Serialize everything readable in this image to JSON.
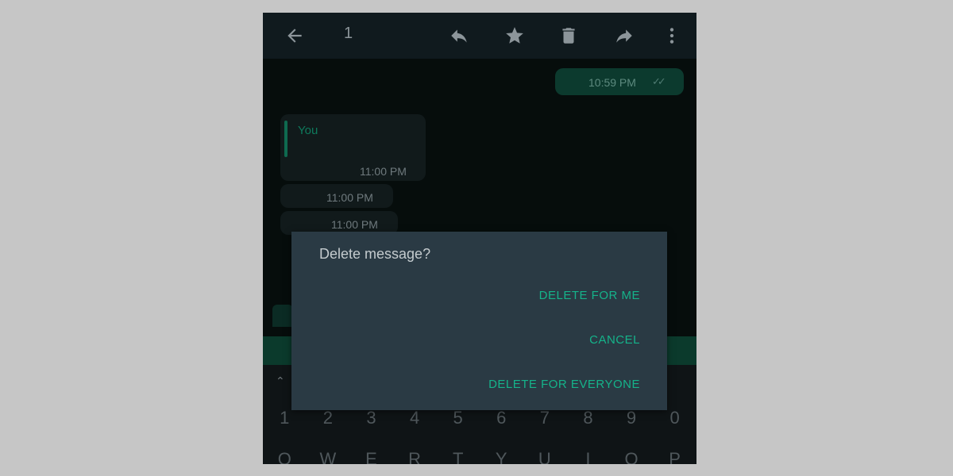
{
  "app_bar": {
    "selected_count": "1",
    "icons": [
      "back-arrow-icon",
      "reply-icon",
      "star-icon",
      "delete-icon",
      "forward-icon",
      "more-vert-icon"
    ]
  },
  "messages": [
    {
      "direction": "outgoing",
      "time": "10:59 PM",
      "status": "read-checks"
    },
    {
      "direction": "incoming",
      "quote_name": "You",
      "time": "11:00 PM"
    },
    {
      "direction": "incoming",
      "time": "11:00 PM"
    },
    {
      "direction": "incoming",
      "time": "11:00 PM"
    }
  ],
  "keyboard": {
    "number_row": [
      "1",
      "2",
      "3",
      "4",
      "5",
      "6",
      "7",
      "8",
      "9",
      "0"
    ],
    "letter_row": [
      "Q",
      "W",
      "E",
      "R",
      "T",
      "Y",
      "U",
      "I",
      "O",
      "P"
    ]
  },
  "dialog": {
    "title": "Delete message?",
    "delete_for_me": "DELETE FOR ME",
    "cancel": "CANCEL",
    "delete_for_everyone": "DELETE FOR EVERYONE"
  },
  "colors": {
    "accent": "#15b38a",
    "dialog_bg": "#2a3a44",
    "outgoing_bubble": "#0c3a2e"
  }
}
